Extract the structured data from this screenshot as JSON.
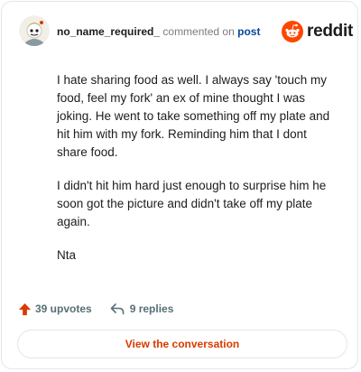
{
  "comment": {
    "username": "no_name_required_",
    "action_text": "commented on",
    "link_text": "post",
    "paragraphs": [
      "I hate sharing food as well. I always say 'touch my food, feel my fork' an ex of mine thought I was joking. He went to take something off my plate and hit him with my fork. Reminding him that I dont share food.",
      "I didn't hit him hard just enough to surprise him he soon got the picture and didn't take off my plate again.",
      "Nta"
    ],
    "upvotes_label": "39 upvotes",
    "replies_label": "9 replies"
  },
  "brand": {
    "wordmark": "reddit",
    "logo_icon": "reddit-snoo-icon"
  },
  "cta": {
    "label": "View the conversation"
  },
  "colors": {
    "accent": "#ff4500",
    "link": "#0a449b",
    "cta_text": "#d93a00",
    "muted": "#7c7c7c"
  }
}
